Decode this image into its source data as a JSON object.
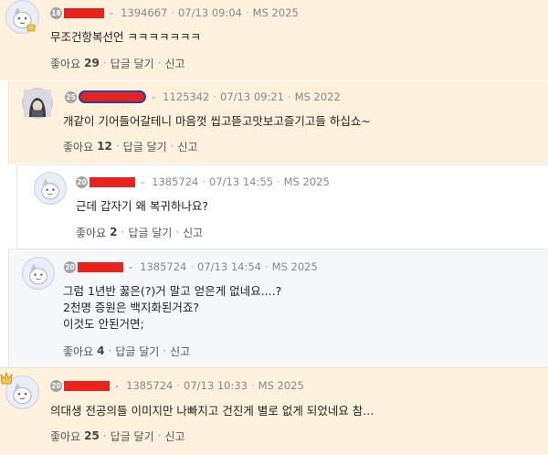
{
  "comments": [
    {
      "level": "18",
      "user_id": "1394667",
      "date": "07/13 09:04",
      "ms": "MS 2025",
      "text": [
        "무조건항복선언 ㅋㅋㅋㅋㅋㅋㅋ"
      ],
      "like_label": "좋아요",
      "likes": "29",
      "reply_label": "답글 달기",
      "report_label": "신고"
    },
    {
      "level": "25",
      "user_id": "1125342",
      "date": "07/13 09:21",
      "ms": "MS 2022",
      "text": [
        "개같이 기어들어갈테니 마음껏 씹고뜯고맛보고즐기고들 하십쇼~"
      ],
      "like_label": "좋아요",
      "likes": "12",
      "reply_label": "답글 달기",
      "report_label": "신고"
    },
    {
      "level": "20",
      "user_id": "1385724",
      "date": "07/13 14:55",
      "ms": "MS 2025",
      "text": [
        "근데 갑자기 왜 복귀하나요?"
      ],
      "like_label": "좋아요",
      "likes": "2",
      "reply_label": "답글 달기",
      "report_label": "신고"
    },
    {
      "level": "20",
      "user_id": "1385724",
      "date": "07/13 14:54",
      "ms": "MS 2025",
      "text": [
        "그럼 1년반 꿇은(?)거 말고 얻은게 없네요....?",
        "2천명 증원은 백지화된거죠?",
        "이것도 안된거면;"
      ],
      "like_label": "좋아요",
      "likes": "4",
      "reply_label": "답글 달기",
      "report_label": "신고"
    },
    {
      "level": "20",
      "user_id": "1385724",
      "date": "07/13 10:33",
      "ms": "MS 2025",
      "text": [
        "의대생 전공의들 이미지만 나빠지고 건진게 별로 없게 되었네요 참..."
      ],
      "like_label": "좋아요",
      "likes": "25",
      "reply_label": "답글 달기",
      "report_label": "신고"
    }
  ],
  "separators": {
    "dash": "-",
    "dot": "·"
  },
  "icons": {
    "avatar": "cartoon-face-icon",
    "photo": "profile-photo",
    "best": "gold-crown-icon"
  },
  "colors": {
    "highlight_bg": "#fdf1dd",
    "redacted": "#e8221c"
  }
}
